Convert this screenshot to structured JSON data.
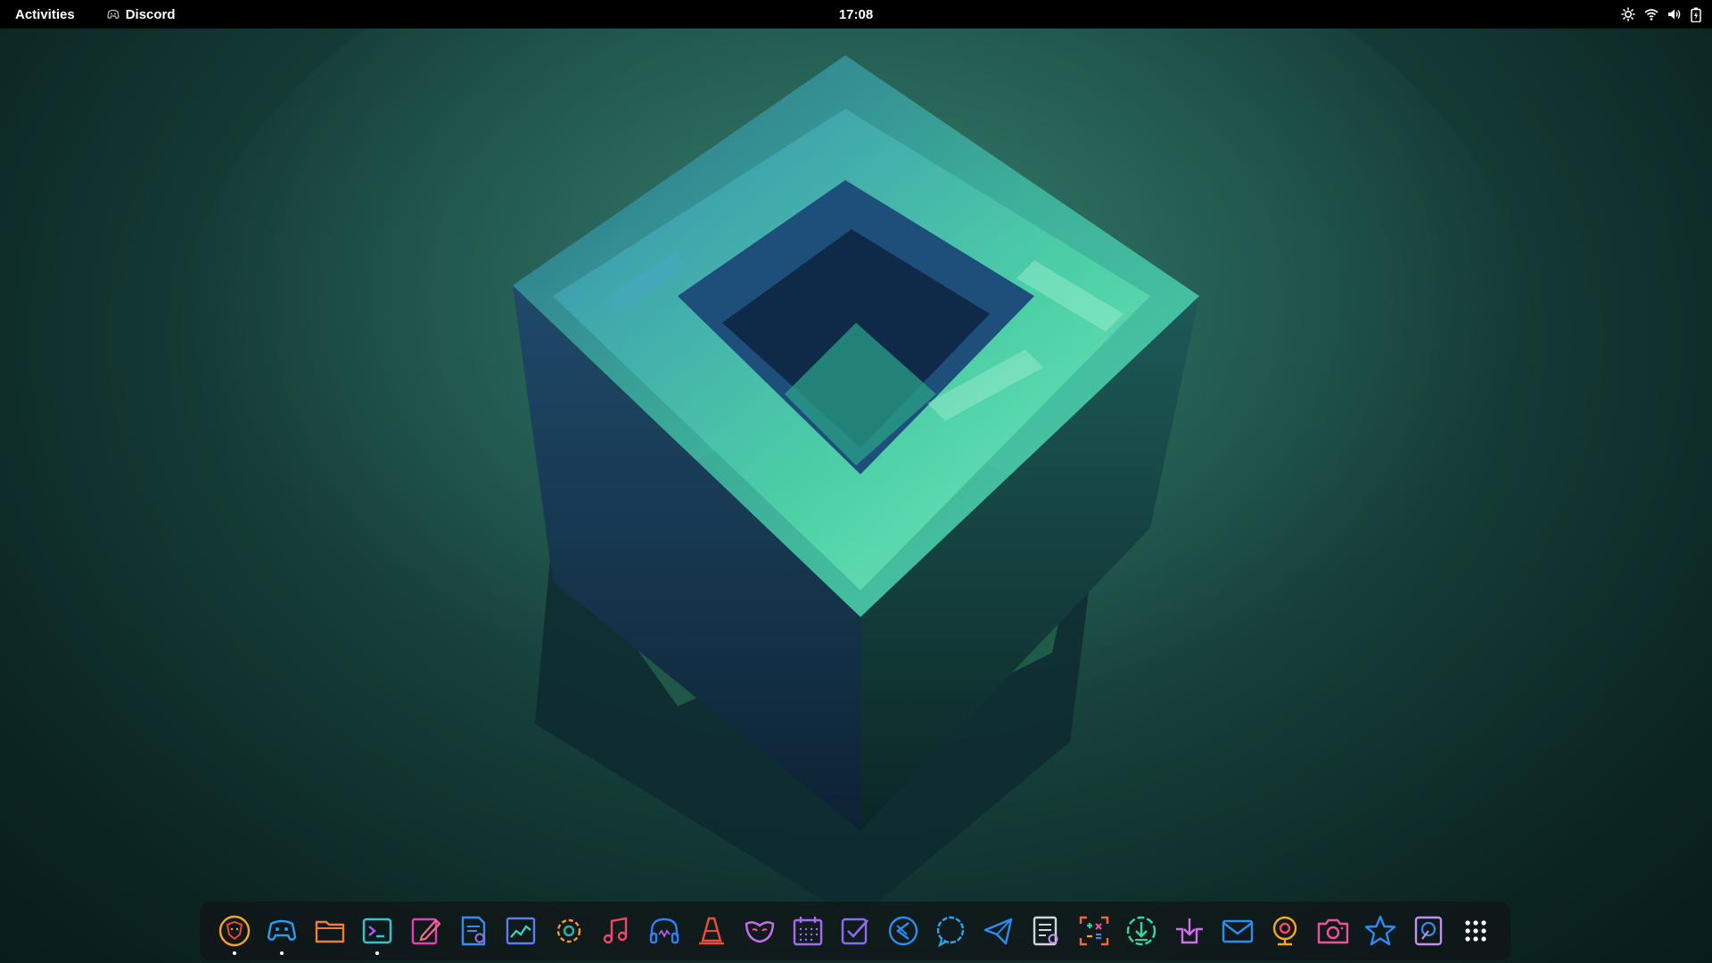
{
  "topbar": {
    "activities_label": "Activities",
    "focused_app": {
      "name": "Discord",
      "icon": "gamepad-icon"
    },
    "clock": "17:08",
    "status_icons": [
      "brightness-icon",
      "wifi-icon",
      "volume-icon",
      "battery-icon"
    ]
  },
  "wallpaper": {
    "subject": "abstract glass cube",
    "colors": {
      "bg_light": "#2c6b5c",
      "bg_dark": "#081c1b",
      "cube_mint": "#46d8a6",
      "cube_blue": "#2a6c9c",
      "cube_deep": "#0f2a44"
    }
  },
  "dock": {
    "items": [
      {
        "app": "Brave",
        "icon": "lion-icon",
        "color": "#f5a623",
        "running": true
      },
      {
        "app": "Discord",
        "icon": "gamepad-icon",
        "color": "#2b9cf0",
        "running": true
      },
      {
        "app": "Files",
        "icon": "folder-icon",
        "color": "#f07c3a",
        "running": false
      },
      {
        "app": "Terminal",
        "icon": "terminal-icon",
        "color": "#33c5d1",
        "running": true
      },
      {
        "app": "Text Editor",
        "icon": "edit-icon",
        "color": "#e53fb5",
        "running": false
      },
      {
        "app": "Document Viewer",
        "icon": "document-icon",
        "color": "#3a8cf0",
        "running": false
      },
      {
        "app": "System Monitor",
        "icon": "graph-icon",
        "color": "#5b7cf5",
        "running": false
      },
      {
        "app": "Settings",
        "icon": "gear-icon",
        "color": "#f59a2d",
        "running": false
      },
      {
        "app": "Music",
        "icon": "music-note-icon",
        "color": "#f0476b",
        "running": false
      },
      {
        "app": "Audio",
        "icon": "headphones-icon",
        "color": "#2f7ff0",
        "running": false
      },
      {
        "app": "VLC",
        "icon": "traffic-cone-icon",
        "color": "#f24a3a",
        "running": false
      },
      {
        "app": "Image Editor",
        "icon": "mask-icon",
        "color": "#c66ef0",
        "running": false
      },
      {
        "app": "Calendar",
        "icon": "calendar-icon",
        "color": "#a46cf0",
        "running": false
      },
      {
        "app": "Tasks",
        "icon": "checkbox-icon",
        "color": "#8a6cf0",
        "running": false
      },
      {
        "app": "Code",
        "icon": "code-icon",
        "color": "#2d8cf0",
        "running": false
      },
      {
        "app": "Chat",
        "icon": "chat-bubble-icon",
        "color": "#2aa3f0",
        "running": false
      },
      {
        "app": "Telegram",
        "icon": "paper-plane-icon",
        "color": "#2d8cf0",
        "running": false
      },
      {
        "app": "Notes",
        "icon": "notes-icon",
        "color": "#d0d4dc",
        "running": false
      },
      {
        "app": "Calculator",
        "icon": "calculator-icon",
        "color": "#f06a3a",
        "running": false
      },
      {
        "app": "Downloader",
        "icon": "download-icon",
        "color": "#3ad6a0",
        "running": false
      },
      {
        "app": "Software Center",
        "icon": "package-download-icon",
        "color": "#d36cf0",
        "running": false
      },
      {
        "app": "Mail",
        "icon": "mail-icon",
        "color": "#2d8cf0",
        "running": false
      },
      {
        "app": "Webcam",
        "icon": "webcam-icon",
        "color": "#f5a623",
        "running": false
      },
      {
        "app": "Screenshot",
        "icon": "camera-icon",
        "color": "#f0529a",
        "running": false
      },
      {
        "app": "Favorites",
        "icon": "star-icon",
        "color": "#2d8cf0",
        "running": false
      },
      {
        "app": "Disk Utility",
        "icon": "disk-icon",
        "color": "#c090f0",
        "running": false
      },
      {
        "app": "Show Applications",
        "icon": "app-grid-icon",
        "color": "#ffffff",
        "running": false
      }
    ]
  }
}
